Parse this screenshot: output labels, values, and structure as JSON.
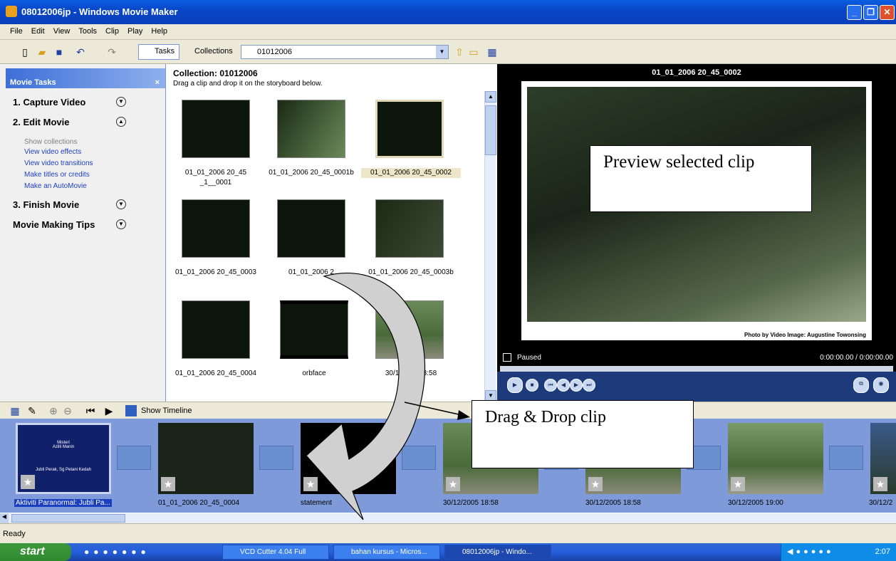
{
  "window": {
    "title": "08012006jp - Windows Movie Maker",
    "min": "_",
    "max": "❐",
    "close": "✕"
  },
  "menu": [
    "File",
    "Edit",
    "View",
    "Tools",
    "Clip",
    "Play",
    "Help"
  ],
  "toolbar": {
    "tasks": "Tasks",
    "collections": "Collections",
    "collection_value": "01012006"
  },
  "tasks": {
    "header": "Movie Tasks",
    "close": "×",
    "capture": "1. Capture Video",
    "edit": "2. Edit Movie",
    "finish": "3. Finish Movie",
    "tips": "Movie Making Tips",
    "links": [
      "Show collections",
      "View video effects",
      "View video transitions",
      "Make titles or credits",
      "Make an AutoMovie"
    ]
  },
  "collection": {
    "title": "Collection: 01012006",
    "subtitle": "Drag a clip and drop it on the storyboard below.",
    "clips": [
      "01_01_2006 20_45\n_1__0001",
      "01_01_2006 20_45_0001b",
      "01_01_2006 20_45_0002",
      "01_01_2006 20_45_0003",
      "01_01_2006 2",
      "01_01_2006 20_45_0003b",
      "01_01_2006 20_45_0004",
      "orbface",
      "30/12/200 18:58"
    ]
  },
  "preview": {
    "title": "01_01_2006 20_45_0002",
    "status": "Paused",
    "time": "0:00:00.00 / 0:00:00.00",
    "credit": "Photo by Video Image: Augustine Towonsing"
  },
  "callouts": {
    "preview": "Preview selected clip",
    "drag": "Drag & Drop clip"
  },
  "storyboard": {
    "show_timeline": "Show Timeline",
    "title_card_line1": "Misteri\nAzilli Manin",
    "title_card_line2": "Jubli Perak, Sg Petani Kedah",
    "clips": [
      "Aktiviti Paranormal: Jubli Pa...",
      "01_01_2006 20_45_0004",
      "statement",
      "30/12/2005 18:58",
      "30/12/2005 18:58",
      "30/12/2005 19:00",
      "30/12/2"
    ]
  },
  "statusbar": "Ready",
  "taskbar": {
    "start": "start",
    "items": [
      "VCD Cutter 4.04 Full",
      "bahan kursus - Micros...",
      "08012006jp - Windo..."
    ],
    "time": "2:07"
  },
  "colors": {
    "accent": "#0a3fb8",
    "storyboard": "#7e9ad8",
    "task_link": "#2040c0"
  }
}
